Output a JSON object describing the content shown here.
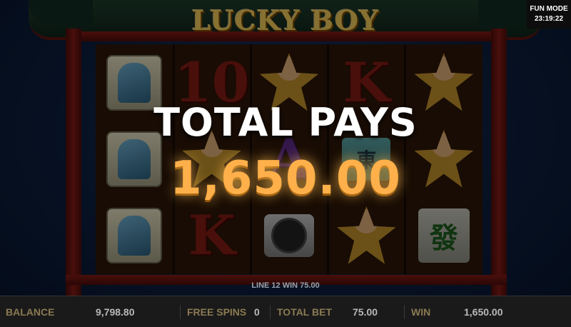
{
  "game": {
    "title": "LUCKY BOY"
  },
  "status": {
    "mode": "FUN MODE",
    "clock": "23:19:22"
  },
  "win_popup": {
    "label": "TOTAL PAYS",
    "amount": "1,650.00"
  },
  "line_win": {
    "text": "LINE 12 WIN 75.00"
  },
  "reels": {
    "rows": [
      [
        "sage-tile",
        "ten",
        "boy-star",
        "king-coin",
        "boy-star"
      ],
      [
        "sage-tile",
        "boy-star",
        "ace",
        "fa-tile-teal",
        "boy-star"
      ],
      [
        "sage-tile",
        "king-coin",
        "mahjong-disc",
        "boy-star",
        "fa-tile"
      ]
    ],
    "letters": {
      "ten": "10",
      "king": "K",
      "ace": "A",
      "fa": "發",
      "fa_small": "東"
    }
  },
  "bottom_bar": {
    "balance_label": "BALANCE",
    "balance_value": "9,798.80",
    "free_spins_label": "FREE SPINS",
    "free_spins_value": "0",
    "total_bet_label": "TOTAL BET",
    "total_bet_value": "75.00",
    "win_label": "WIN",
    "win_value": "1,650.00"
  },
  "colors": {
    "accent_orange": "#ffb04a",
    "frame_red": "#7e1b14",
    "title_gold": "#e7c356"
  }
}
